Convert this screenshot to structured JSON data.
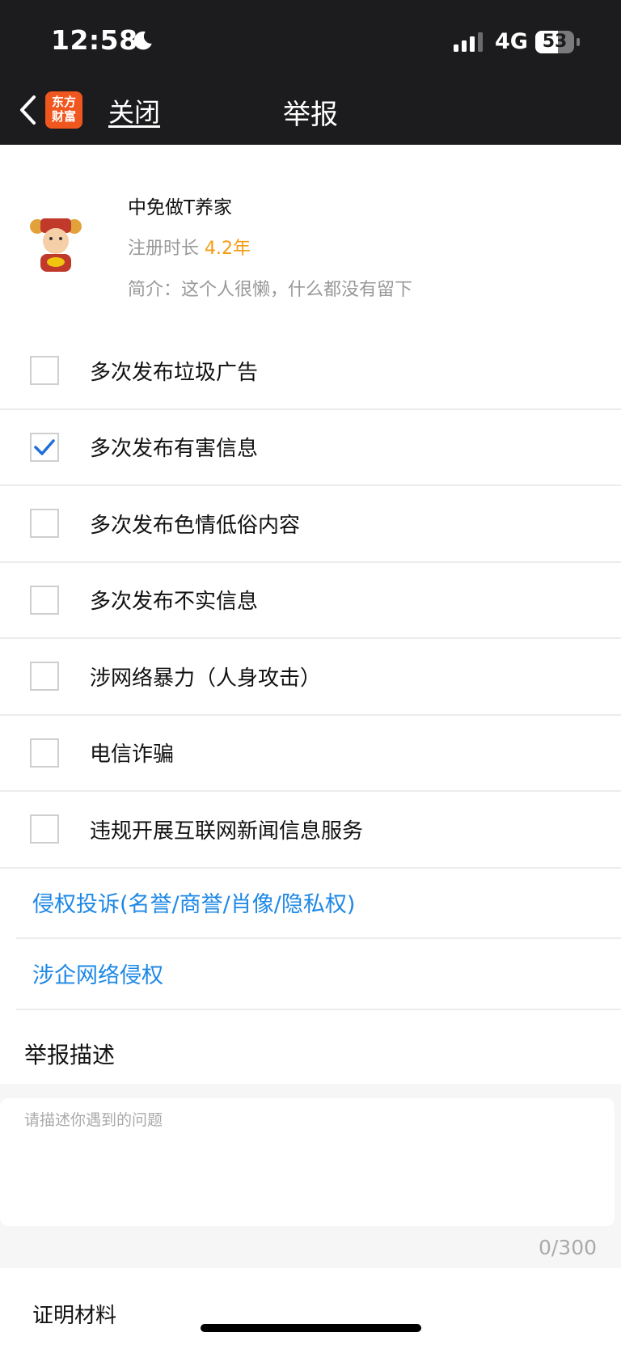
{
  "status_bar": {
    "time": "12:58",
    "network": "4G",
    "battery": "53"
  },
  "nav": {
    "logo_line1": "东方",
    "logo_line2": "财富",
    "close_label": "关闭",
    "title": "举报"
  },
  "profile": {
    "username": "中免做T养家",
    "reg_label": "注册时长",
    "reg_value": "4.2年",
    "bio": "简介：这个人很懒，什么都没有留下"
  },
  "options": [
    {
      "label": "多次发布垃圾广告",
      "checked": false
    },
    {
      "label": "多次发布有害信息",
      "checked": true
    },
    {
      "label": "多次发布色情低俗内容",
      "checked": false
    },
    {
      "label": "多次发布不实信息",
      "checked": false
    },
    {
      "label": "涉网络暴力（人身攻击）",
      "checked": false
    },
    {
      "label": "电信诈骗",
      "checked": false
    },
    {
      "label": "违规开展互联网新闻信息服务",
      "checked": false
    }
  ],
  "links": [
    {
      "label": "侵权投诉(名誉/商誉/肖像/隐私权)"
    },
    {
      "label": "涉企网络侵权"
    }
  ],
  "description": {
    "title": "举报描述",
    "placeholder": "请描述你遇到的问题",
    "counter": "0/300"
  },
  "proof_title": "证明材料",
  "colors": {
    "accent_blue": "#1e88e5",
    "orange": "#f39c12",
    "logo_red": "#f0571f",
    "topbar": "#1c1c1e"
  }
}
